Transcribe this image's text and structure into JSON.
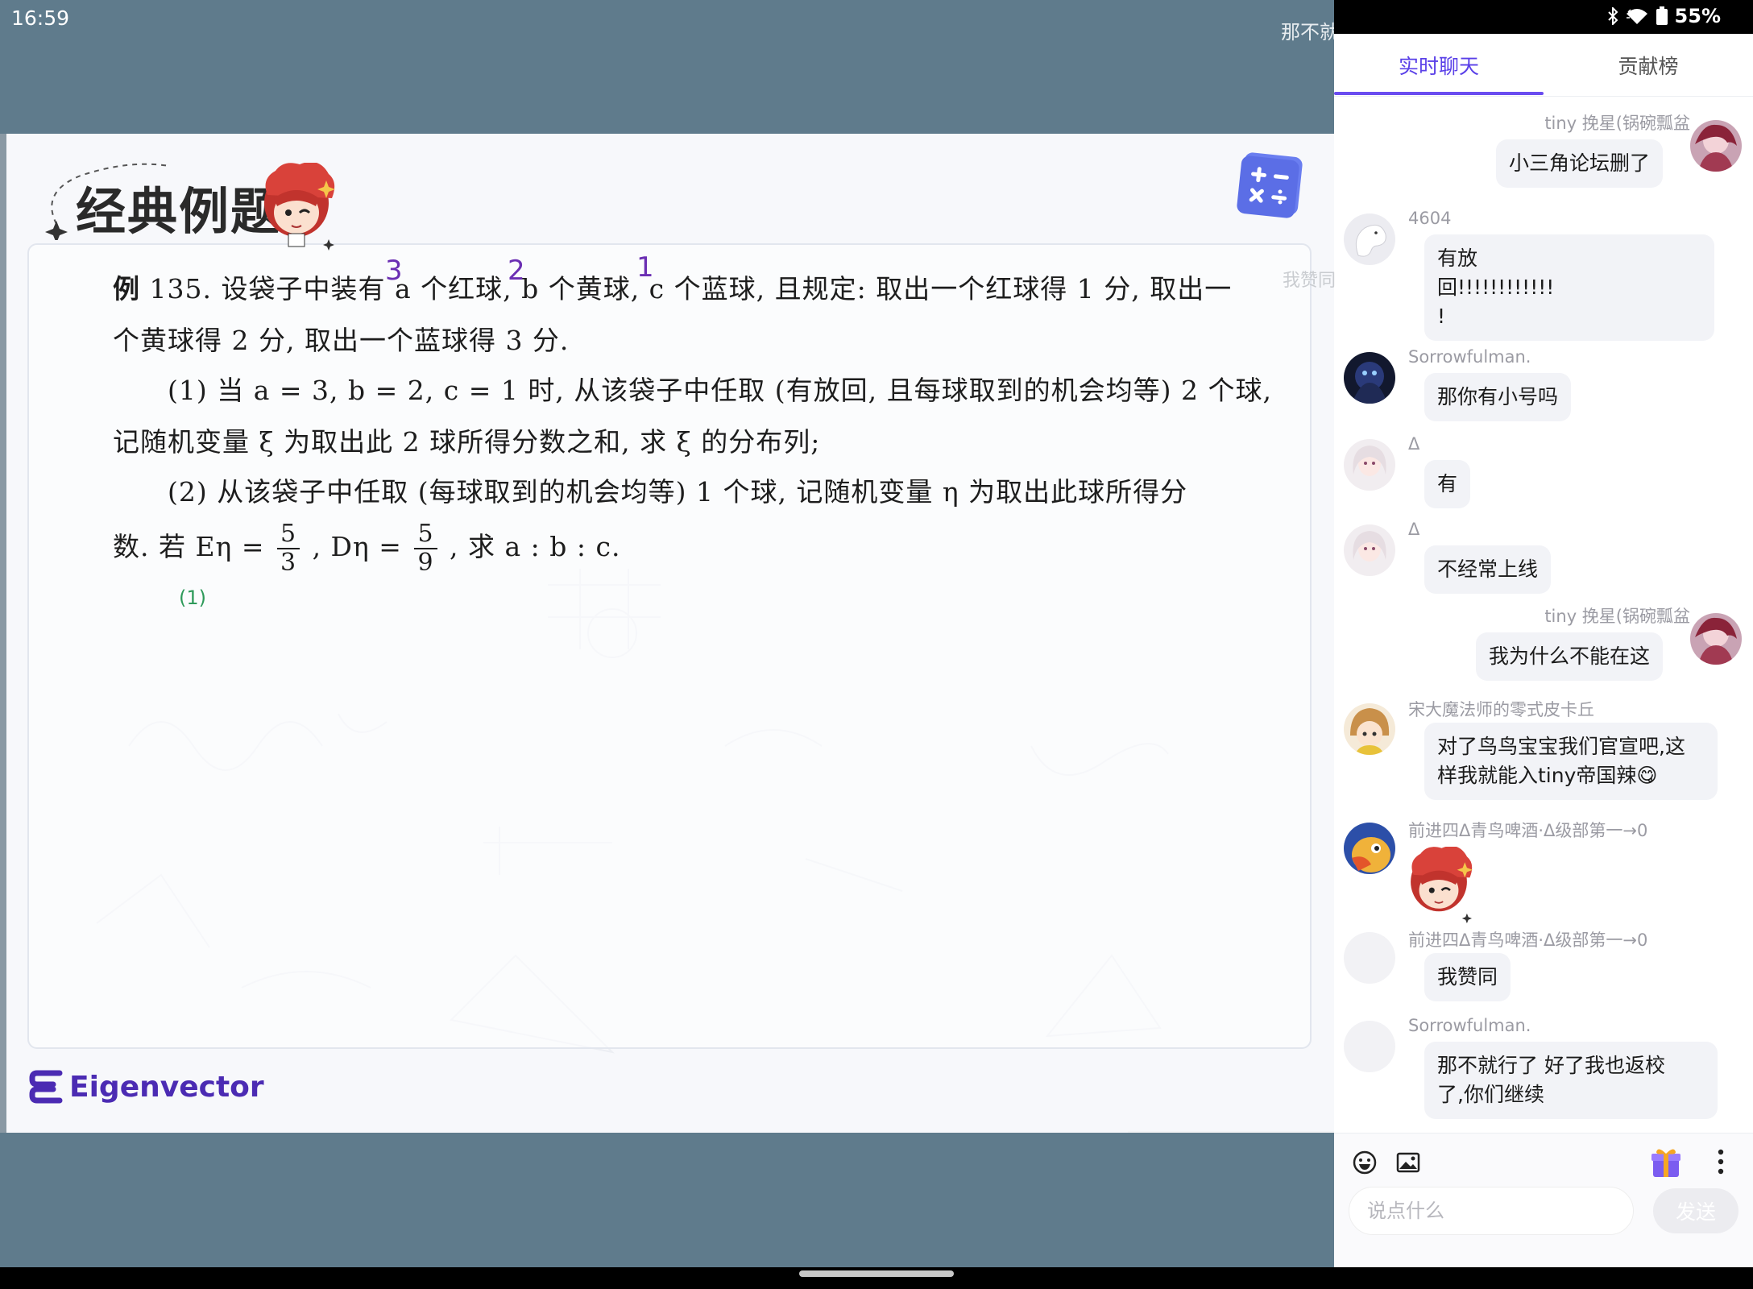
{
  "status_bar": {
    "time": "16:59",
    "battery": "55%"
  },
  "danmaku": {
    "top": "那不就",
    "mid": "我赞同"
  },
  "slide": {
    "title": "经典例题",
    "problem": {
      "line1_pre": "例",
      "line1": " 135. 设袋子中装有 a 个红球, b 个黄球, c 个蓝球, 且规定: 取出一个红球得 1 分, 取出一",
      "line2": "个黄球得 2 分, 取出一个蓝球得 3 分.",
      "line3": "(1) 当 a = 3, b = 2, c = 1 时, 从该袋子中任取 (有放回, 且每球取到的机会均等) 2 个球,",
      "line4": "记随机变量 ξ 为取出此 2 球所得分数之和, 求 ξ 的分布列;",
      "line5": "(2) 从该袋子中任取 (每球取到的机会均等) 1 个球, 记随机变量 η 为取出此球所得分",
      "line6_a": "数. 若 Eη =",
      "frac1_num": "5",
      "frac1_den": "3",
      "line6_b": ", Dη =",
      "frac2_num": "5",
      "frac2_den": "9",
      "line6_c": ", 求 a : b : c."
    },
    "handwritten": {
      "mark_a": "3",
      "mark_b": "2",
      "mark_c": "1",
      "part_label": "(1)"
    },
    "brand": "Eigenvector"
  },
  "chat": {
    "tabs": [
      "实时聊天",
      "贡献榜"
    ],
    "active_tab": 0,
    "messages": [
      {
        "user": "tiny 挽星(锅碗瓢盆",
        "text": "小三角论坛删了",
        "side": "right"
      },
      {
        "user": "4604",
        "text": "有放\n回!!!!!!!!!!!!\n!",
        "side": "left"
      },
      {
        "user": "Sorrowfulman.",
        "text": "那你有小号吗",
        "side": "left"
      },
      {
        "user": "Δ",
        "text": "有",
        "side": "left"
      },
      {
        "user": "Δ",
        "text": "不经常上线",
        "side": "left"
      },
      {
        "user": "tiny 挽星(锅碗瓢盆",
        "text": "我为什么不能在这",
        "side": "right"
      },
      {
        "user": "宋大魔法师的零式皮卡丘",
        "text": "对了鸟鸟宝宝我们官宣吧,这\n样我就能入tiny帝国辣😋",
        "side": "left"
      },
      {
        "user": "前进四Δ青鸟啤酒·Δ级部第一→0",
        "text": "",
        "side": "left",
        "sticker": true
      },
      {
        "user": "前进四Δ青鸟啤酒·Δ级部第一→0",
        "text": "我赞同",
        "side": "left"
      },
      {
        "user": "Sorrowfulman.",
        "text": "那不就行了  好了我也返校\n了,你们继续",
        "side": "left"
      }
    ],
    "input_placeholder": "说点什么",
    "send_label": "发送"
  },
  "colors": {
    "accent": "#6a4cf0",
    "video_bg": "#5f7b8c",
    "ink": "#6b2fb3",
    "handwriting_green": "#2e9a5a"
  },
  "icons": [
    "bluetooth-icon",
    "wifi-icon",
    "battery-icon",
    "calculator-icon",
    "emoji-icon",
    "image-icon",
    "gift-icon",
    "more-icon"
  ]
}
